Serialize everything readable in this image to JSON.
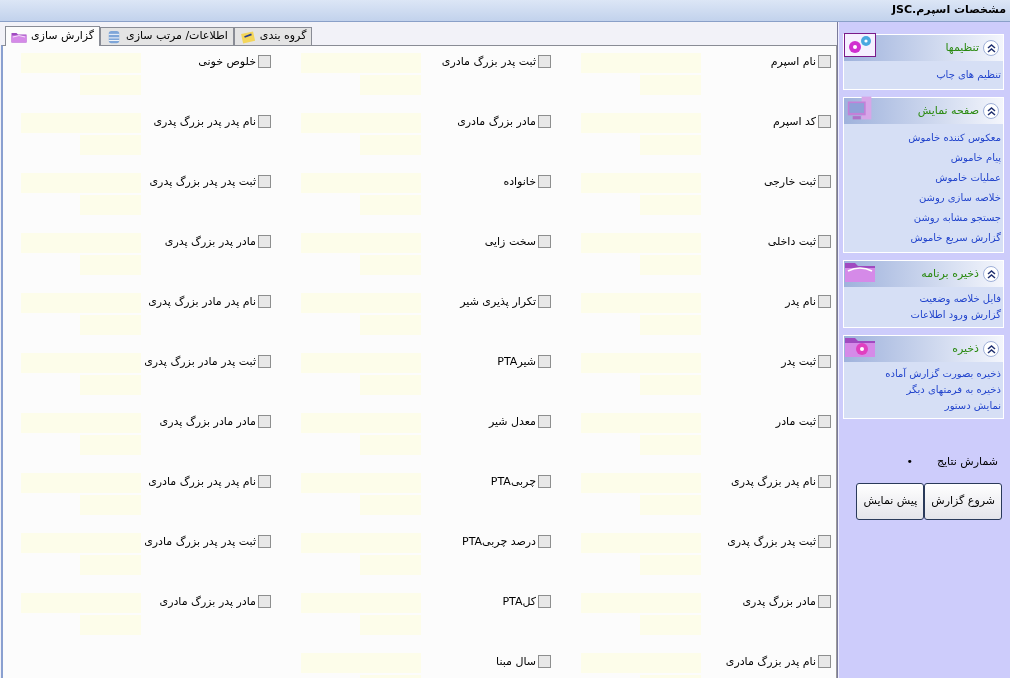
{
  "window": {
    "title": "مشخصات اسپرم.JSC"
  },
  "tabs": [
    {
      "label": "گروه بندی",
      "selected": false
    },
    {
      "label": "اطلاعات/ مرتب سازی",
      "selected": false
    },
    {
      "label": "گزارش سازی",
      "selected": true
    }
  ],
  "columns": [
    {
      "fields": [
        {
          "label": "نام اسپرم",
          "checked": false
        },
        {
          "label": "کد اسپرم",
          "checked": false
        },
        {
          "label": "ثبت خارجی",
          "checked": false
        },
        {
          "label": "ثبت داخلی",
          "checked": false
        },
        {
          "label": "نام پدر",
          "checked": false
        },
        {
          "label": "ثبت پدر",
          "checked": false
        },
        {
          "label": "ثبت مادر",
          "checked": false
        },
        {
          "label": "نام پدر بزرگ پدری",
          "checked": false
        },
        {
          "label": "ثبت پدر بزرگ پدری",
          "checked": false
        },
        {
          "label": "مادر بزرگ پدری",
          "checked": false
        },
        {
          "label": "نام پدر بزرگ مادری",
          "checked": false
        }
      ]
    },
    {
      "fields": [
        {
          "label": "ثبت پدر بزرگ مادری",
          "checked": false
        },
        {
          "label": "مادر بزرگ مادری",
          "checked": false
        },
        {
          "label": "خانواده",
          "checked": false
        },
        {
          "label": "سخت زایی",
          "checked": false
        },
        {
          "label": "تکرار پذیری شیر",
          "checked": false
        },
        {
          "label": "شیرPTA",
          "checked": false
        },
        {
          "label": "معدل شیر",
          "checked": false
        },
        {
          "label": "چربیPTA",
          "checked": false
        },
        {
          "label": "درصد چربیPTA",
          "checked": false
        },
        {
          "label": "کلPTA",
          "checked": false
        },
        {
          "label": "سال مبنا",
          "checked": false
        }
      ]
    },
    {
      "fields": [
        {
          "label": "خلوص خونی",
          "checked": false
        },
        {
          "label": "نام پدر پدر بزرگ پدری",
          "checked": false
        },
        {
          "label": "ثبت پدر پدر بزرگ پدری",
          "checked": false
        },
        {
          "label": "مادر پدر بزرگ پدری",
          "checked": false
        },
        {
          "label": "نام پدر مادر بزرگ پدری",
          "checked": false
        },
        {
          "label": "ثبت پدر مادر بزرگ پدری",
          "checked": false
        },
        {
          "label": "مادر مادر بزرگ پدری",
          "checked": false
        },
        {
          "label": "نام پدر پدر بزرگ مادری",
          "checked": false
        },
        {
          "label": "ثبت پدر پدر بزرگ مادری",
          "checked": false
        },
        {
          "label": "مادر پدر بزرگ مادری",
          "checked": false
        }
      ]
    }
  ],
  "sidebar": {
    "panels": [
      {
        "title": "تنظیمها",
        "expanded": true,
        "links": [
          "تنظیم های چاپ"
        ]
      },
      {
        "title": "صفحه نمایش",
        "expanded": true,
        "links": [
          "معکوس کننده خاموش",
          "پیام خاموش",
          "عملیات خاموش",
          "خلاصه سازی روشن",
          "جستجو مشابه روشن",
          "گزارش سریع خاموش"
        ]
      },
      {
        "title": "ذخیره برنامه",
        "expanded": true,
        "links": [
          "فایل خلاصه وضعیت",
          "گزارش ورود اطلاعات"
        ]
      },
      {
        "title": "ذخیره",
        "expanded": true,
        "links": [
          "ذخیره بصورت گزارش آماده",
          "ذخیره به فرمتهای دیگر",
          "نمایش دستور"
        ]
      }
    ],
    "result_count": {
      "label": "شمارش نتایج",
      "value": "•"
    },
    "buttons": [
      "شروع گزارش",
      "پیش نمایش"
    ]
  }
}
